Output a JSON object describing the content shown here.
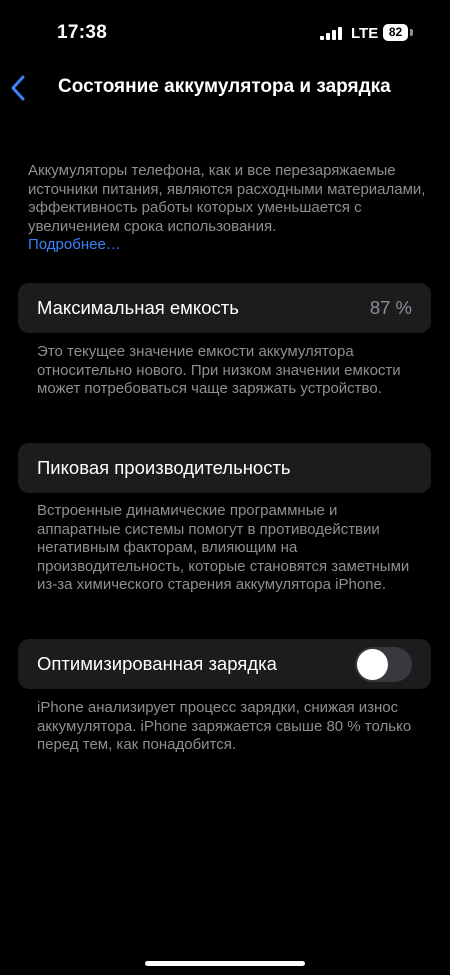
{
  "status_bar": {
    "time": "17:38",
    "network": "LTE",
    "battery": "82"
  },
  "nav": {
    "title": "Состояние аккумулятора и зарядка",
    "back_icon": "chevron-left-icon"
  },
  "intro": {
    "text": "Аккумуляторы телефона, как и все перезаряжаемые источники питания, являются расходными материалами, эффективность работы которых уменьшается с увеличением срока использования.",
    "link": "Подробнее…"
  },
  "max_capacity": {
    "label": "Максимальная емкость",
    "value": "87 %",
    "footnote": "Это текущее значение емкости аккумулятора относительно нового. При низком значении емкости может потребоваться чаще заряжать устройство."
  },
  "peak_performance": {
    "label": "Пиковая производительность",
    "footnote": "Встроенные динамические программные и аппаратные системы помогут в противодействии негативным факторам, влияющим на производительность, которые становятся заметными из-за химического старения аккумулятора iPhone."
  },
  "optimized_charging": {
    "label": "Оптимизированная зарядка",
    "enabled": false,
    "footnote": "iPhone анализирует процесс зарядки, снижая износ аккумулятора. iPhone заряжается свыше 80 % только перед тем, как понадобится."
  },
  "colors": {
    "background": "#000000",
    "cell": "#1c1c1e",
    "secondary_text": "#8e8e93",
    "link": "#3b82f6",
    "toggle_off": "#39393d"
  }
}
